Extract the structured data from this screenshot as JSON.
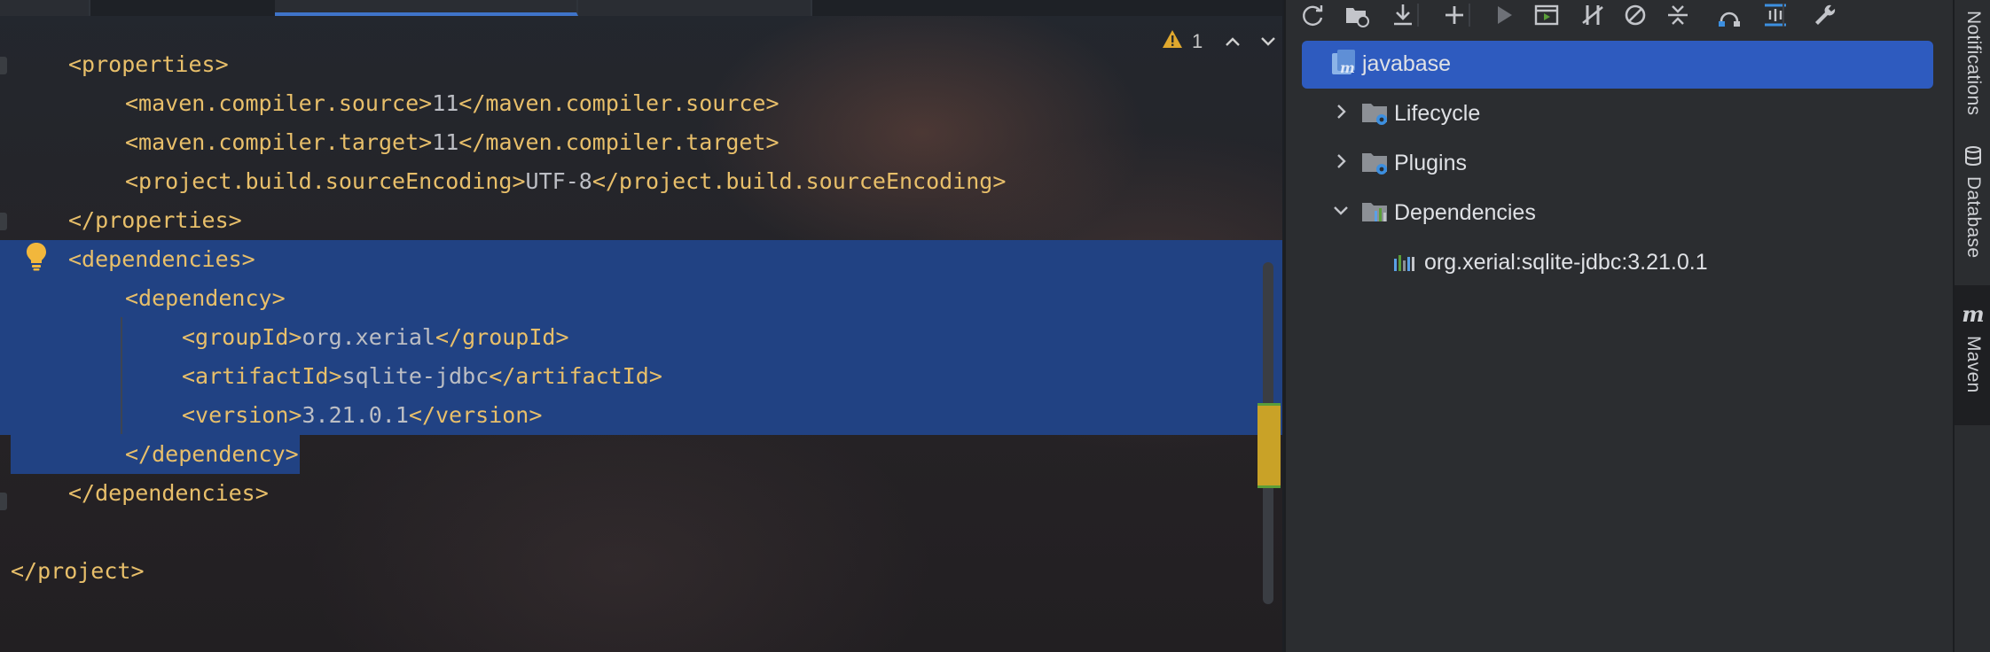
{
  "editor": {
    "inspections": {
      "warning_count": "1"
    },
    "lines": [
      {
        "indent": 1,
        "parts": [
          [
            "tag",
            "<properties>"
          ]
        ]
      },
      {
        "indent": 2,
        "parts": [
          [
            "tag",
            "<maven.compiler.source>"
          ],
          [
            "val",
            "11"
          ],
          [
            "tag",
            "</maven.compiler.source>"
          ]
        ]
      },
      {
        "indent": 2,
        "parts": [
          [
            "tag",
            "<maven.compiler.target>"
          ],
          [
            "val",
            "11"
          ],
          [
            "tag",
            "</maven.compiler.target>"
          ]
        ]
      },
      {
        "indent": 2,
        "parts": [
          [
            "tag",
            "<project.build.sourceEncoding>"
          ],
          [
            "val",
            "UTF-8"
          ],
          [
            "tag",
            "</project.build.sourceEncoding>"
          ]
        ]
      },
      {
        "indent": 1,
        "parts": [
          [
            "tag",
            "</properties>"
          ]
        ]
      },
      {
        "indent": 1,
        "parts": [
          [
            "tag",
            "<dependencies>"
          ]
        ],
        "selected": "full"
      },
      {
        "indent": 2,
        "parts": [
          [
            "tag",
            "<dependency>"
          ]
        ],
        "selected": "full"
      },
      {
        "indent": 3,
        "parts": [
          [
            "tag",
            "<groupId>"
          ],
          [
            "val",
            "org.xerial"
          ],
          [
            "tag",
            "</groupId>"
          ]
        ],
        "selected": "full"
      },
      {
        "indent": 3,
        "parts": [
          [
            "tag",
            "<artifactId>"
          ],
          [
            "val",
            "sqlite-jdbc"
          ],
          [
            "tag",
            "</artifactId>"
          ]
        ],
        "selected": "full"
      },
      {
        "indent": 3,
        "parts": [
          [
            "tag",
            "<version>"
          ],
          [
            "val",
            "3.21.0.1"
          ],
          [
            "tag",
            "</version>"
          ]
        ],
        "selected": "full"
      },
      {
        "indent": 2,
        "parts": [
          [
            "tag",
            "</dependency>"
          ]
        ],
        "selected": "partial"
      },
      {
        "indent": 1,
        "parts": [
          [
            "tag",
            "</dependencies>"
          ]
        ]
      },
      {
        "indent": 0,
        "parts": []
      },
      {
        "indent": 0,
        "parts": [
          [
            "tag",
            "</project>"
          ]
        ]
      }
    ]
  },
  "maven": {
    "toolbar": [
      "reload-icon",
      "reload-folder-icon",
      "download-icon",
      "add-icon",
      "run-icon",
      "run-config-icon",
      "toggle-offline-icon",
      "skip-tests-icon",
      "collapse-all-icon",
      "show-dependencies-icon",
      "analyze-icon",
      "settings-wrench-icon"
    ],
    "tree": [
      {
        "label": "javabase",
        "level": 0,
        "icon": "maven-project-icon",
        "selected": true,
        "chevron": ""
      },
      {
        "label": "Lifecycle",
        "level": 1,
        "icon": "lifecycle-folder-icon",
        "chevron": "right"
      },
      {
        "label": "Plugins",
        "level": 1,
        "icon": "plugins-folder-icon",
        "chevron": "right"
      },
      {
        "label": "Dependencies",
        "level": 1,
        "icon": "dependencies-folder-icon",
        "chevron": "down"
      },
      {
        "label": "org.xerial:sqlite-jdbc:3.21.0.1",
        "level": 2,
        "icon": "library-icon",
        "chevron": ""
      }
    ]
  },
  "side_stripe": {
    "notifications": "Notifications",
    "database": "Database",
    "maven": "Maven"
  },
  "colors": {
    "tag": "#e8bf6a",
    "value": "#bcbec4",
    "selection": "#214283",
    "tree_selection": "#2e5bbf",
    "warning": "#e0a82e"
  }
}
